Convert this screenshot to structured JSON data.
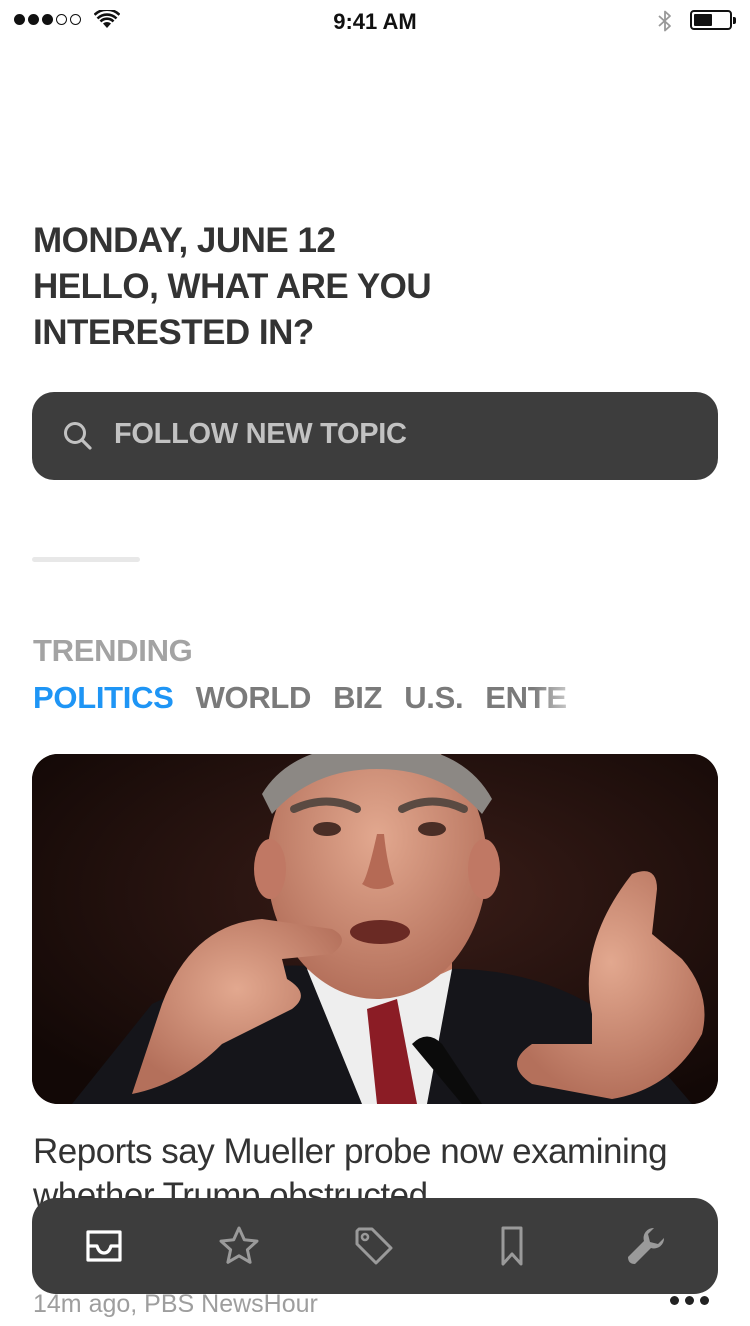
{
  "status_bar": {
    "time": "9:41 AM"
  },
  "greeting": {
    "date": "MONDAY, JUNE 12",
    "line1": "HELLO, WHAT ARE YOU",
    "line2": "INTERESTED IN?"
  },
  "search": {
    "label": "FOLLOW NEW TOPIC",
    "icon": "search-icon"
  },
  "trending": {
    "label": "TRENDING",
    "topics": [
      "POLITICS",
      "WORLD",
      "BIZ",
      "U.S.",
      "ENTE"
    ],
    "active_index": 0,
    "active_color": "#1e95f5"
  },
  "article": {
    "headline": "Reports say Mueller probe now examining whether Trump obstructed",
    "meta": "14m ago, PBS NewsHour"
  },
  "tabbar": {
    "items": [
      {
        "icon": "inbox-icon",
        "active": true
      },
      {
        "icon": "star-icon",
        "active": false
      },
      {
        "icon": "tag-icon",
        "active": false
      },
      {
        "icon": "bookmark-icon",
        "active": false
      },
      {
        "icon": "wrench-icon",
        "active": false
      }
    ],
    "background": "#3d3d3d"
  }
}
